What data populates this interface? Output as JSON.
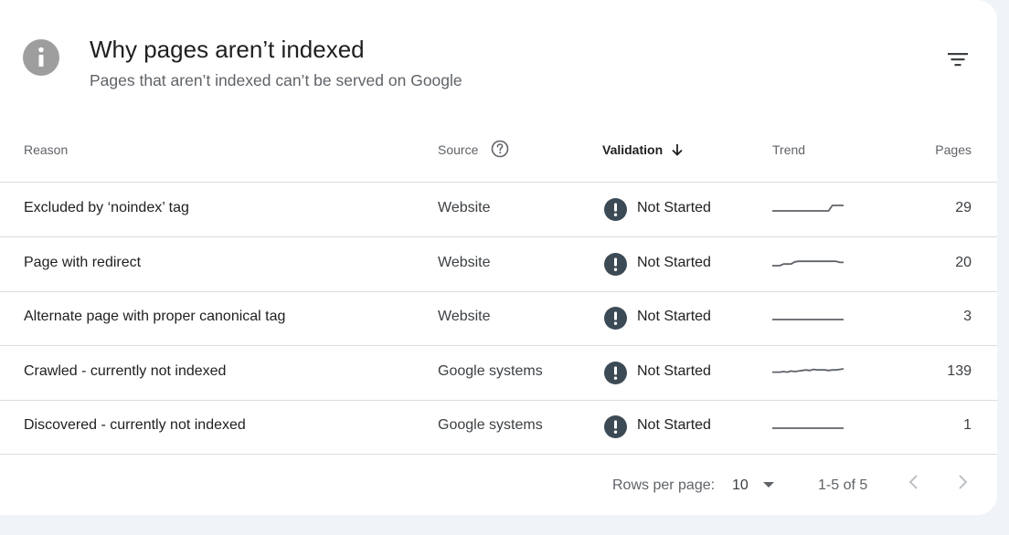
{
  "header": {
    "title": "Why pages aren’t indexed",
    "subtitle": "Pages that aren’t indexed can’t be served on Google"
  },
  "table": {
    "columns": {
      "reason": "Reason",
      "source": "Source",
      "validation": "Validation",
      "trend": "Trend",
      "pages": "Pages"
    },
    "rows": [
      {
        "reason": "Excluded by ‘noindex’ tag",
        "source": "Website",
        "validation": "Not Started",
        "pages": "29",
        "trend": [
          0,
          0,
          0,
          0,
          0,
          0,
          0,
          0,
          0,
          0,
          0,
          0,
          0,
          0,
          0,
          0,
          1,
          1,
          1,
          1
        ]
      },
      {
        "reason": "Page with redirect",
        "source": "Website",
        "validation": "Not Started",
        "pages": "20",
        "trend": [
          0,
          0,
          0,
          0.3,
          0.3,
          0.3,
          0.7,
          0.8,
          0.8,
          0.8,
          0.8,
          0.8,
          0.8,
          0.8,
          0.8,
          0.8,
          0.8,
          0.8,
          0.6,
          0.6
        ]
      },
      {
        "reason": "Alternate page with proper canonical tag",
        "source": "Website",
        "validation": "Not Started",
        "pages": "3",
        "trend": [
          0,
          0,
          0,
          0,
          0,
          0,
          0,
          0,
          0,
          0,
          0,
          0,
          0,
          0,
          0,
          0,
          0,
          0,
          0,
          0
        ]
      },
      {
        "reason": "Crawled - currently not indexed",
        "source": "Google systems",
        "validation": "Not Started",
        "pages": "139",
        "trend": [
          0.4,
          0.4,
          0.4,
          0.5,
          0.4,
          0.6,
          0.5,
          0.6,
          0.7,
          0.8,
          0.7,
          0.9,
          0.8,
          0.8,
          0.8,
          0.7,
          0.8,
          0.8,
          0.9,
          1
        ]
      },
      {
        "reason": "Discovered - currently not indexed",
        "source": "Google systems",
        "validation": "Not Started",
        "pages": "1",
        "trend": [
          0,
          0,
          0,
          0,
          0,
          0,
          0,
          0,
          0,
          0,
          0,
          0,
          0,
          0,
          0,
          0,
          0,
          0,
          0,
          0
        ]
      }
    ]
  },
  "footer": {
    "rows_per_page_label": "Rows per page:",
    "rows_per_page_value": "10",
    "range": "1-5 of 5"
  },
  "icons": {
    "header": "info-icon",
    "filter": "filter-icon",
    "source_help": "help-icon",
    "sort": "arrow-down-icon",
    "status": "alert-icon",
    "prev": "chevron-left-icon",
    "next": "chevron-right-icon"
  },
  "colors": {
    "info_icon": "#9e9e9e",
    "alert_icon": "#3c4a55",
    "sparkline": "#5f6368",
    "divider": "#dadce0"
  }
}
